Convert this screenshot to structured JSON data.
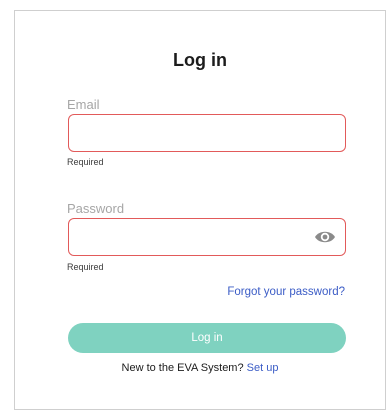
{
  "form": {
    "title": "Log in",
    "email": {
      "label": "Email",
      "value": "",
      "helper": "Required"
    },
    "password": {
      "label": "Password",
      "value": "",
      "helper": "Required"
    },
    "forgot_link": "Forgot your password?",
    "submit_label": "Log in",
    "signup_prompt": "New to the EVA System?",
    "signup_link": "Set up"
  },
  "colors": {
    "error_border": "#e25a5a",
    "primary_button": "#7fd2c0",
    "link": "#3b5cc6"
  },
  "icons": {
    "password_toggle": "eye-icon"
  }
}
